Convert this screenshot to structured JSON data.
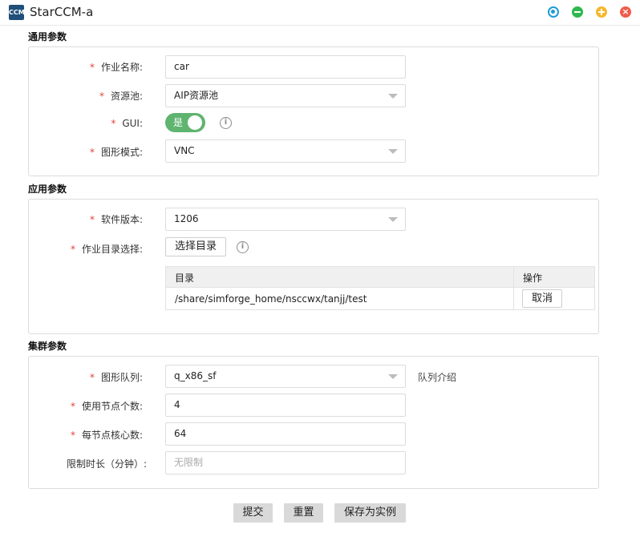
{
  "window": {
    "title": "StarCCM-a",
    "app_icon_text": "CCM",
    "controls": [
      {
        "name": "settings",
        "color": "#1e9bd7"
      },
      {
        "name": "minimize",
        "color": "#2fb84f"
      },
      {
        "name": "add",
        "color": "#f5b82e"
      },
      {
        "name": "close",
        "color": "#ef5b4b"
      }
    ]
  },
  "sections": {
    "general": "通用参数",
    "application": "应用参数",
    "cluster": "集群参数"
  },
  "required_mark": "*",
  "general": {
    "job_name_label": "作业名称:",
    "job_name_value": "car",
    "resource_pool_label": "资源池:",
    "resource_pool_value": "AIP资源池",
    "gui_label": "GUI:",
    "gui_toggle_text": "是",
    "gui_on": true,
    "graphics_mode_label": "图形模式:",
    "graphics_mode_value": "VNC"
  },
  "application": {
    "software_version_label": "软件版本:",
    "software_version_value": "1206",
    "job_dir_label": "作业目录选择:",
    "choose_dir_button": "选择目录",
    "table": {
      "columns": [
        "目录",
        "操作"
      ],
      "rows": [
        {
          "dir": "/share/simforge_home/nsccwx/tanjj/test",
          "action": "取消"
        }
      ]
    }
  },
  "cluster": {
    "queue_label": "图形队列:",
    "queue_value": "q_x86_sf",
    "queue_intro_link": "队列介绍",
    "nodes_label": "使用节点个数:",
    "nodes_value": "4",
    "cores_label": "每节点核心数:",
    "cores_value": "64",
    "time_limit_label": "限制时长（分钟）:",
    "time_limit_placeholder": "无限制"
  },
  "footer": {
    "submit": "提交",
    "reset": "重置",
    "save_as_example": "保存为实例"
  },
  "colors": {
    "toggle_on": "#5fb46f",
    "required": "#e0443a",
    "footer_button": "#d9d9d9"
  }
}
